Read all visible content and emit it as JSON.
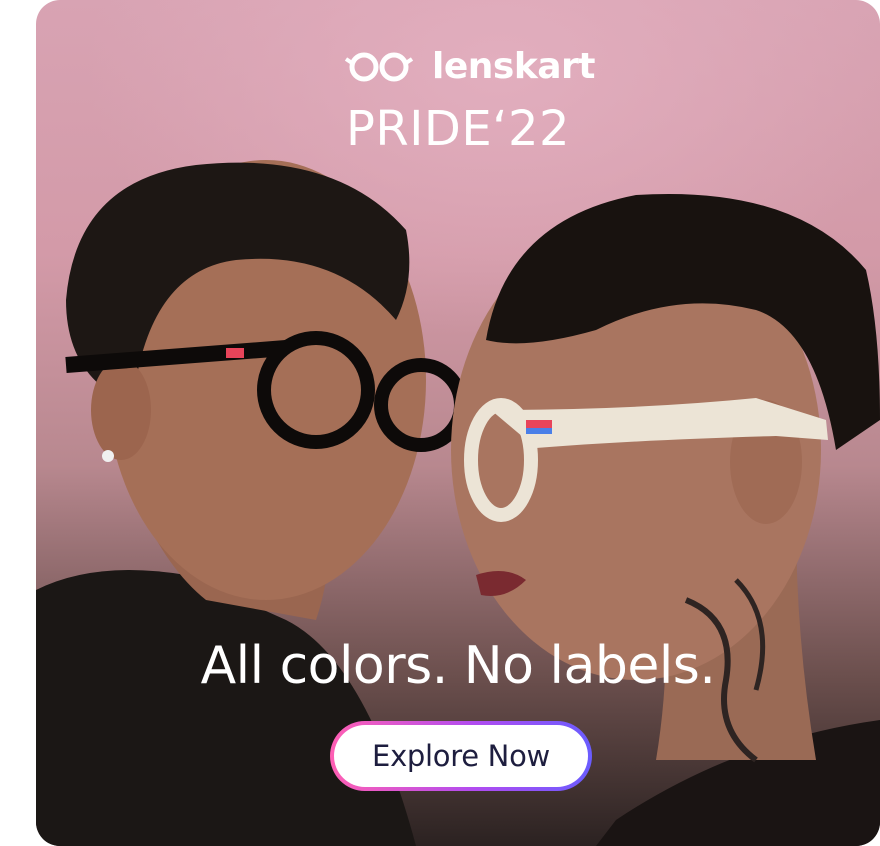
{
  "banner": {
    "brand_name": "lenskart",
    "campaign_title": "PRIDE‘22",
    "tagline": "All colors. No labels.",
    "cta_label": "Explore Now",
    "logo_icon": "glasses-logo-icon"
  },
  "colors": {
    "background_top": "#d8a3b3",
    "background_bottom": "#2b2221",
    "text": "#ffffff",
    "cta_gradient_start": "#ff5fb3",
    "cta_gradient_end": "#6a5cff",
    "cta_text": "#1e1e3f"
  }
}
